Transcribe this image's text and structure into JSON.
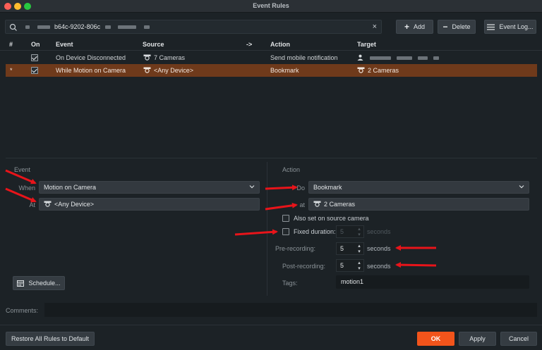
{
  "window": {
    "title": "Event Rules"
  },
  "search": {
    "text": "b64c-9202-806c"
  },
  "toolbar": {
    "add_label": "Add",
    "delete_label": "Delete",
    "log_label": "Event Log..."
  },
  "table": {
    "headers": {
      "num": "#",
      "on": "On",
      "event": "Event",
      "source": "Source",
      "arrow": "->",
      "action": "Action",
      "target": "Target"
    },
    "rows": [
      {
        "num": "",
        "on": true,
        "event": "On Device Disconnected",
        "source": "7 Cameras",
        "action": "Send mobile notification",
        "target": ""
      },
      {
        "num": "*",
        "on": true,
        "event": "While Motion on Camera",
        "source": "<Any Device>",
        "action": "Bookmark",
        "target": "2 Cameras"
      }
    ]
  },
  "event": {
    "section_label": "Event",
    "when_label": "When",
    "when_value": "Motion on Camera",
    "at_label": "At",
    "at_value": "<Any Device>",
    "schedule_label": "Schedule..."
  },
  "action": {
    "section_label": "Action",
    "do_label": "Do",
    "do_value": "Bookmark",
    "at_label": "at",
    "at_value": "2 Cameras",
    "also_source_label": "Also set on source camera",
    "fixed_duration_label": "Fixed duration:",
    "fixed_duration_value": "5",
    "fixed_duration_unit": "seconds",
    "pre_label": "Pre-recording:",
    "pre_value": "5",
    "pre_unit": "seconds",
    "post_label": "Post-recording:",
    "post_value": "5",
    "post_unit": "seconds",
    "tags_label": "Tags:",
    "tags_value": "motion1"
  },
  "comments": {
    "label": "Comments:",
    "value": ""
  },
  "footer": {
    "restore_label": "Restore All Rules to Default",
    "ok_label": "OK",
    "apply_label": "Apply",
    "cancel_label": "Cancel"
  },
  "colors": {
    "accent": "#f2541b",
    "selected_row": "#6f3a1b",
    "annotation_arrow": "#e8141a"
  }
}
